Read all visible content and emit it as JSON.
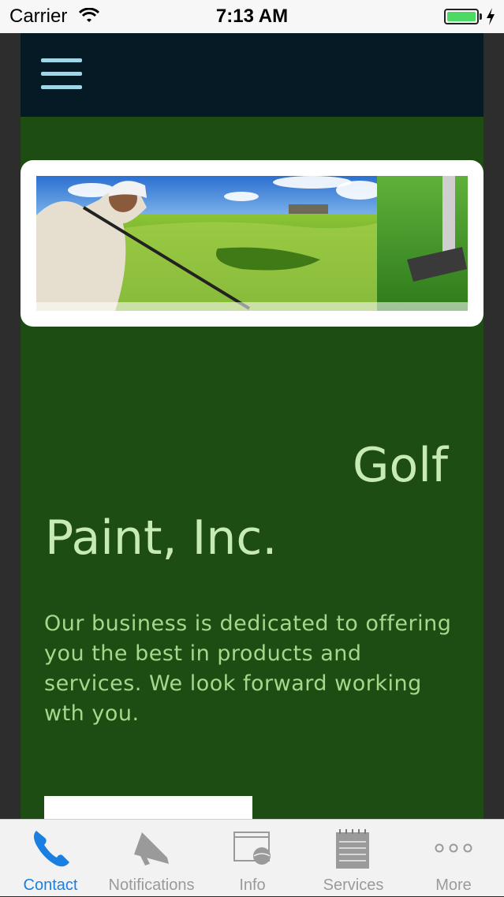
{
  "status_bar": {
    "carrier": "Carrier",
    "time": "7:13 AM"
  },
  "header": {
    "menu_icon": "hamburger-menu-icon"
  },
  "banner": {
    "image_subject": "golfer swinging on course with putter close-up"
  },
  "main": {
    "title_line1": "Golf",
    "title_line2": "Paint, Inc.",
    "paragraph": "Our business is dedicated to offering\nyou the best in products and\nservices.  We look forward working\nwth you."
  },
  "tabs": [
    {
      "label": "Contact",
      "icon": "phone-icon",
      "active": true
    },
    {
      "label": "Notifications",
      "icon": "megaphone-icon",
      "active": false
    },
    {
      "label": "Info",
      "icon": "browser-globe-icon",
      "active": false
    },
    {
      "label": "Services",
      "icon": "notepad-icon",
      "active": false
    },
    {
      "label": "More",
      "icon": "more-dots-icon",
      "active": false
    }
  ],
  "colors": {
    "header_bg": "#061a26",
    "content_bg": "#1e4d14",
    "title_text": "#c7ecb3",
    "body_text": "#a6d88c",
    "tab_active": "#1a7fe0",
    "tab_inactive": "#9a9a9a",
    "menu_icon": "#9fd6e8"
  }
}
